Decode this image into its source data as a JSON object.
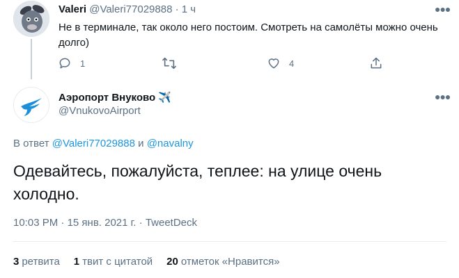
{
  "reply": {
    "name": "Valeri",
    "handle": "@Valeri77029888",
    "time": "1 ч",
    "text": "Не в терминале, так около него постоим. Смотреть на самолёты можно очень долго)",
    "replies": "1",
    "retweets": "",
    "likes": "4",
    "icons": [
      "reply-icon",
      "retweet-icon",
      "like-icon",
      "share-icon",
      "more-icon"
    ]
  },
  "tweet": {
    "name": "Аэропорт Внуково ✈️",
    "handle": "@VnukovoAirport",
    "replying_prefix": "В ответ",
    "mention1": "@Valeri77029888",
    "and": "и",
    "mention2": "@navalny",
    "text": "Одевайтесь, пожалуйста, теплее: на улице очень холодно.",
    "time": "10:03 PM",
    "date": "15 янв. 2021 г.",
    "separator": "·",
    "source": "TweetDeck"
  },
  "stats": {
    "retweets_count": "3",
    "retweets_label": "ретвита",
    "quotes_count": "1",
    "quotes_label": "твит с цитатой",
    "likes_count": "20",
    "likes_label": "отметок «Нравится»"
  },
  "colors": {
    "link": "#1b95e0",
    "muted": "#5b7083",
    "divider": "#e6ecf0",
    "brand": "#1d8fd8"
  }
}
